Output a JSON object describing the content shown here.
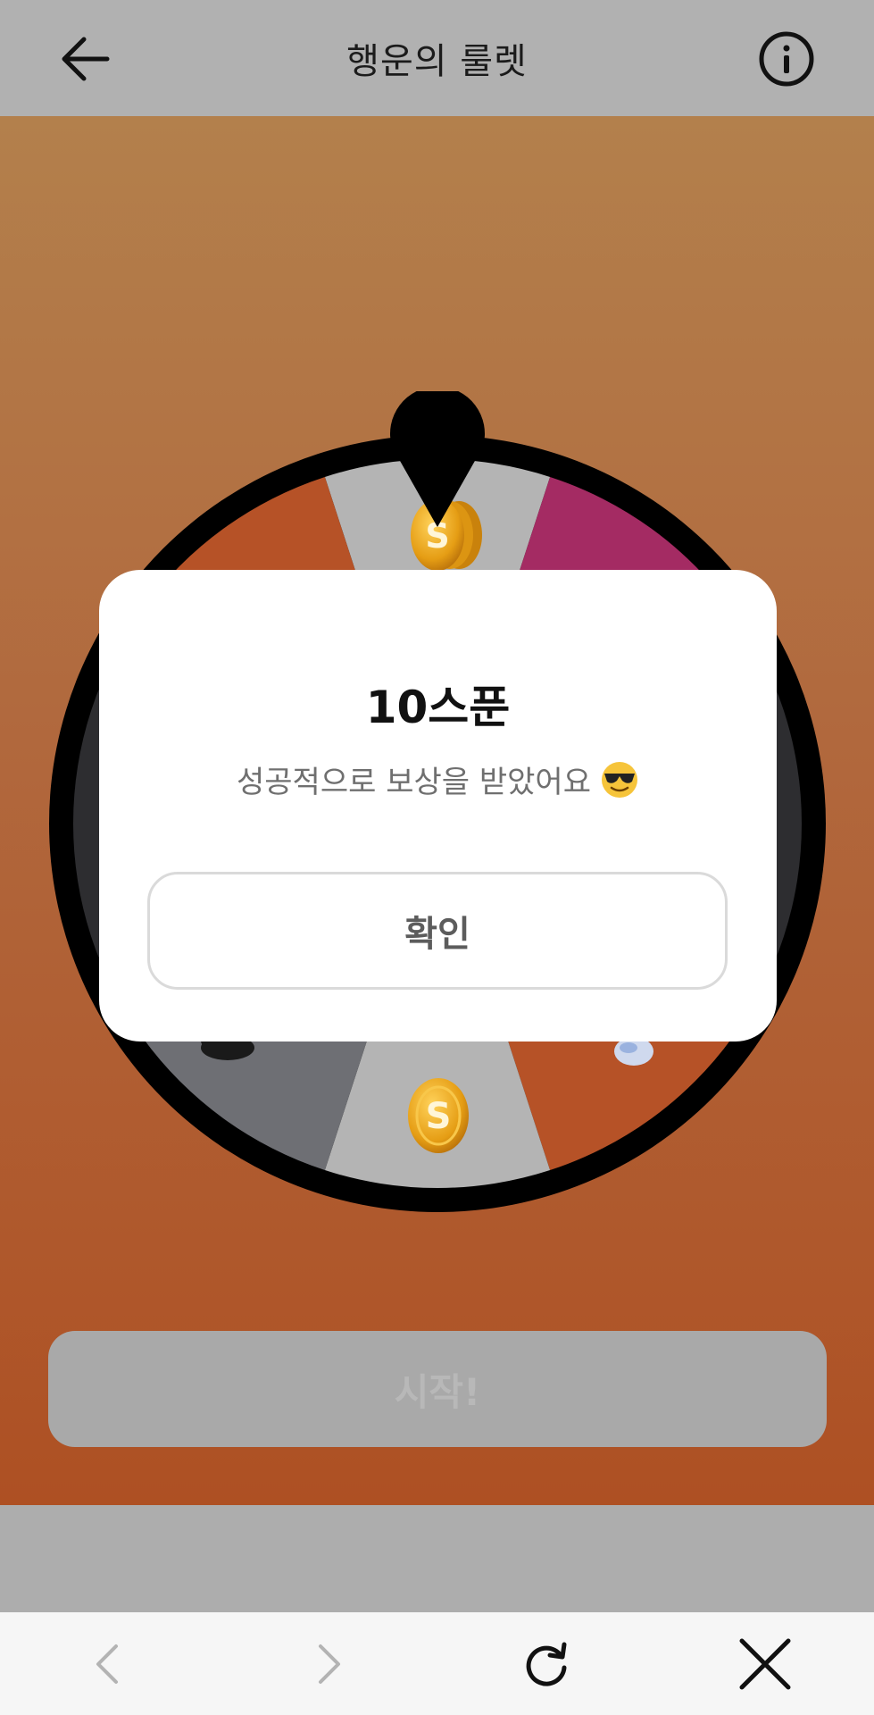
{
  "header": {
    "title": "행운의 룰렛",
    "back_icon": "arrow-left-icon",
    "info_icon": "info-circle-icon"
  },
  "wheel": {
    "segment_colors": [
      "#b4b4b4",
      "#a42b63",
      "#2d2d30",
      "#2d2d30",
      "#b65227",
      "#b4b4b4",
      "#6e6f74",
      "#2d2d30",
      "#2d2d30",
      "#b65227"
    ],
    "rim_color": "#000000",
    "pointer_icon": "map-pin-pointer-icon",
    "prize_icons": [
      "coin-stack-icon",
      "coin-icon",
      "cloud-icon",
      "fish-icon"
    ]
  },
  "start_button": {
    "label": "시작!"
  },
  "result_modal": {
    "title": "10스푼",
    "message": "성공적으로 보상을 받았어요",
    "emoji": "sunglasses-face-icon",
    "confirm_label": "확인"
  },
  "toolbar": {
    "back_icon": "chevron-left-icon",
    "forward_icon": "chevron-right-icon",
    "reload_icon": "reload-icon",
    "close_icon": "close-icon"
  },
  "colors": {
    "accent_orange": "#b1683d",
    "header_gray": "#b1b1b1",
    "modal_white": "#ffffff"
  }
}
